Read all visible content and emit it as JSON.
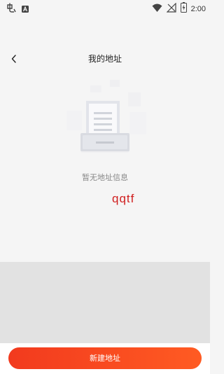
{
  "status_bar": {
    "time": "2:00",
    "left_icons": [
      "mascot-icon",
      "a-box-icon"
    ],
    "right_icons": [
      "wifi-icon",
      "no-signal-icon",
      "battery-charging-icon"
    ]
  },
  "header": {
    "title": "我的地址",
    "back_icon": "chevron-left-icon"
  },
  "empty_state": {
    "message": "暂无地址信息",
    "illustration": "empty-document-tray-icon"
  },
  "overlay": {
    "text": "qqtf"
  },
  "bottom_bar": {
    "add_button_label": "新建地址"
  },
  "colors": {
    "background": "#f5f5f5",
    "accent_start": "#f23a1e",
    "accent_end": "#ff5b22",
    "overlay_text": "#d02020",
    "grey_band": "#e2e2e2"
  }
}
